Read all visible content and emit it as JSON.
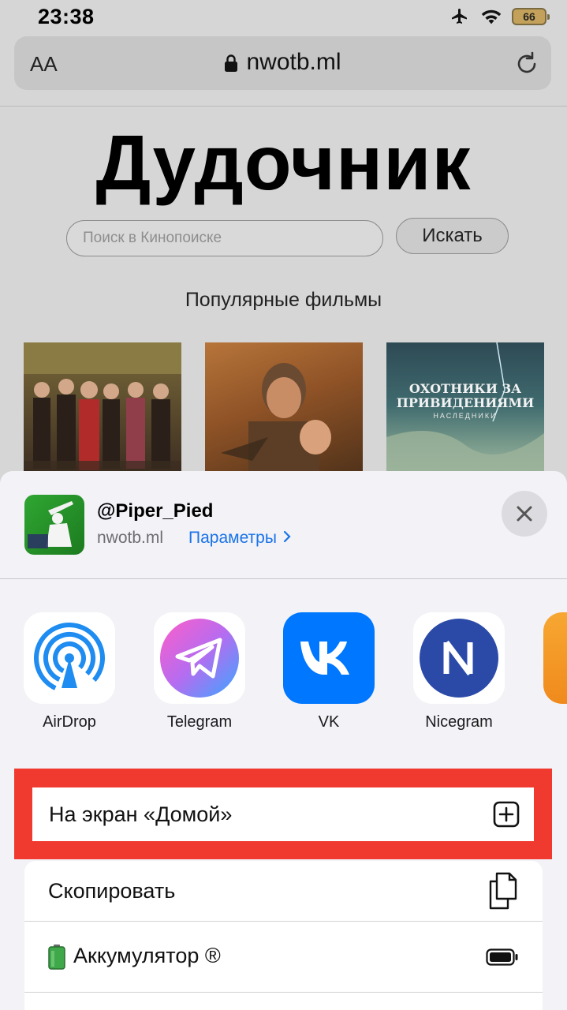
{
  "status_bar": {
    "time": "23:38",
    "battery_level": "66",
    "icons": [
      "airplane-icon",
      "wifi-icon",
      "battery-icon"
    ]
  },
  "browser": {
    "text_size_label": "AA",
    "domain": "nwotb.ml",
    "icons": [
      "lock-icon",
      "reload-icon"
    ]
  },
  "page": {
    "title": "Дудочник",
    "search_placeholder": "Поиск в Кинопоиске",
    "search_button": "Искать",
    "section_title": "Популярные фильмы",
    "posters": [
      {
        "overlay_text": ""
      },
      {
        "overlay_text": ""
      },
      {
        "overlay_text": "ОХОТНИКИ ЗА ПРИВИДЕНИЯМИ",
        "overlay_sub": "НАСЛЕДНИКИ"
      }
    ]
  },
  "share_sheet": {
    "channel_name": "@Piper_Pied",
    "domain": "nwotb.ml",
    "options_link": "Параметры",
    "apps": [
      {
        "label": "AirDrop",
        "icon": "airdrop-icon"
      },
      {
        "label": "Telegram",
        "icon": "telegram-icon"
      },
      {
        "label": "VK",
        "icon": "vk-icon"
      },
      {
        "label": "Nicegram",
        "icon": "nicegram-icon"
      }
    ],
    "actions": [
      {
        "label": "На экран «Домой»",
        "icon": "add-square-icon",
        "highlighted": true
      },
      {
        "label": "Скопировать",
        "icon": "copy-icon"
      },
      {
        "label": "Аккумулятор ®",
        "icon": "battery-full-icon"
      }
    ],
    "colors": {
      "highlight": "#f03a30",
      "link": "#1a73e8",
      "vk": "#0077ff",
      "nicegram": "#2b4aa8"
    }
  }
}
